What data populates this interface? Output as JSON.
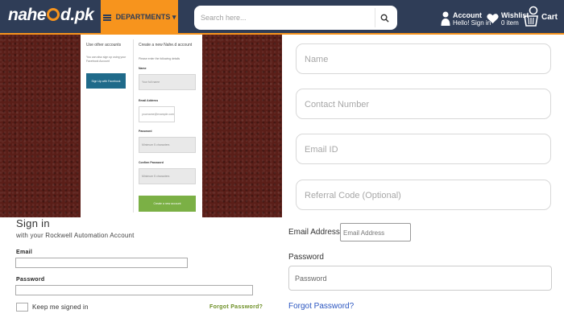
{
  "header": {
    "logo_text_left": "nahe",
    "logo_text_right": "d.pk",
    "departments_label": "DEPARTMENTS ▾",
    "search_placeholder": "Search here...",
    "account_title": "Account",
    "account_sub": "Hello! Sign in",
    "wishlist_title": "Wishlist",
    "wishlist_sub": "0 item",
    "cart_label": "Cart"
  },
  "embedded_modal": {
    "left_heading": "Use other accounts",
    "left_text": "You can also sign up using your Facebook Account",
    "facebook_button": "Sign Up with Facebook",
    "right_heading": "Create a new Nahe.d account",
    "right_text": "Please enter the following details",
    "name_label": "Name",
    "name_placeholder": "Your full name",
    "email_label": "Email Address",
    "email_placeholder": "yourname@example.com",
    "password_label": "Password",
    "password_placeholder": "Minimum 5 characters",
    "confirm_label": "Confirm Password",
    "confirm_placeholder": "Minimum 5 characters",
    "create_button": "Create a new account"
  },
  "signin": {
    "title": "Sign in",
    "subtitle": "with your Rockwell Automation Account",
    "email_label": "Email",
    "password_label": "Password",
    "keep_signed_in": "Keep me signed in",
    "forgot": "Forgot Password?"
  },
  "right_fields": {
    "name_placeholder": "Name",
    "contact_placeholder": "Contact Number",
    "email_placeholder": "Email ID",
    "referral_placeholder": "Referral Code (Optional)"
  },
  "bottom_right": {
    "email_label": "Email Address",
    "email_placeholder": "Email Address",
    "password_label": "Password",
    "password_placeholder": "Password",
    "forgot": "Forgot Password?"
  },
  "colors": {
    "header_bg": "#2f3d57",
    "accent_orange": "#f7941d",
    "facebook_blue": "#1f6a8a",
    "create_green": "#7bb045",
    "forgot_olive": "#6b8e23",
    "link_blue": "#2a55c0"
  },
  "icons": [
    "hamburger-icon",
    "search-icon",
    "user-icon",
    "heart-icon",
    "cart-icon"
  ]
}
